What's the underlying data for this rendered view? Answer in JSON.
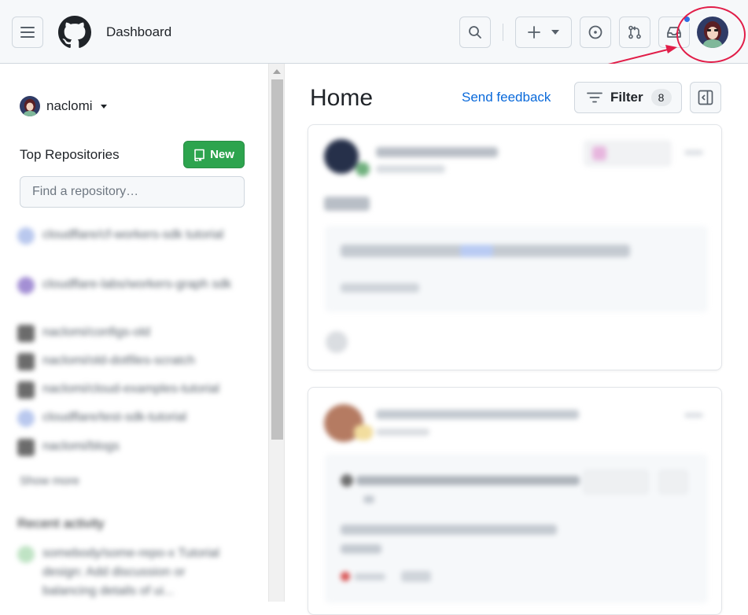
{
  "header": {
    "title": "Dashboard"
  },
  "sidebar": {
    "username": "naclomi",
    "top_repositories_label": "Top Repositories",
    "new_button_label": "New",
    "find_placeholder": "Find a repository…",
    "repos": [
      {
        "name": "cloudflare/cf-workers-sdk tutorial",
        "color": "#b9c8ee"
      },
      {
        "name": "cloudflare-labs/workers-graph sdk",
        "color": "#a38fd4"
      },
      {
        "name": "naclomi/configs-old",
        "color": "#6b6b6b"
      },
      {
        "name": "naclomi/old-dotfiles-scratch",
        "color": "#6b6b6b"
      },
      {
        "name": "naclomi/cloud-examples-tutorial",
        "color": "#6b6b6b"
      },
      {
        "name": "cloudflare/test-sdk-tutorial",
        "color": "#b9c8ee"
      },
      {
        "name": "naclomi/blogs",
        "color": "#6b6b6b"
      }
    ],
    "show_more": "Show more",
    "recent_activity_label": "Recent activity",
    "recent_activity_text": "somebody/some-repo-x Tutorial design: Add discussion or balancing details of ui..."
  },
  "main": {
    "title": "Home",
    "send_feedback": "Send feedback",
    "filter_label": "Filter",
    "filter_count": "8"
  },
  "colors": {
    "accent": "#0969da",
    "new_button": "#2da44e",
    "notification_dot": "#2f6fe4",
    "highlight": "#e11d48"
  }
}
